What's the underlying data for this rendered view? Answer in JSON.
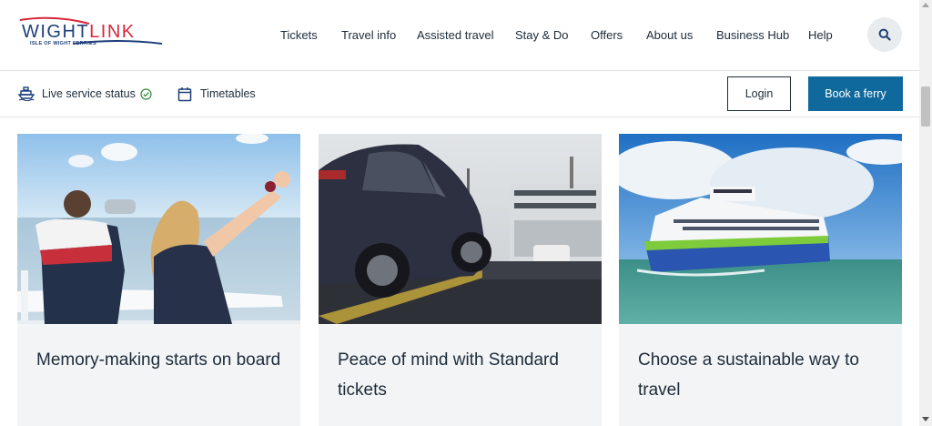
{
  "brand": {
    "logo_word_primary": "WIGHT",
    "logo_word_secondary": "LINK",
    "logo_subtitle": "ISLE OF WIGHT FERRIES",
    "colors": {
      "navy": "#1e3f7a",
      "red": "#d8283a",
      "primary_button": "#10699c",
      "text": "#1d2b3a"
    }
  },
  "nav": {
    "items": [
      {
        "label": "Tickets"
      },
      {
        "label": "Travel info"
      },
      {
        "label": "Assisted travel"
      },
      {
        "label": "Stay & Do"
      },
      {
        "label": "Offers"
      },
      {
        "label": "About us"
      },
      {
        "label": "Business Hub"
      },
      {
        "label": "Help"
      }
    ],
    "search_icon": "search-icon"
  },
  "subbar": {
    "live_status_label": "Live service status",
    "live_status_icon": "ferry-icon",
    "status_check_icon": "check-circle-icon",
    "timetables_label": "Timetables",
    "timetables_icon": "calendar-icon",
    "login_label": "Login",
    "book_label": "Book a ferry"
  },
  "cards": [
    {
      "title": "Memory-making starts on board",
      "image": "children-on-ferry-deck-photo"
    },
    {
      "title": "Peace of mind with Standard tickets",
      "image": "car-boarding-ferry-photo"
    },
    {
      "title": "Choose a sustainable way to travel",
      "image": "victoria-of-wight-hybrid-ferry-photo"
    }
  ]
}
